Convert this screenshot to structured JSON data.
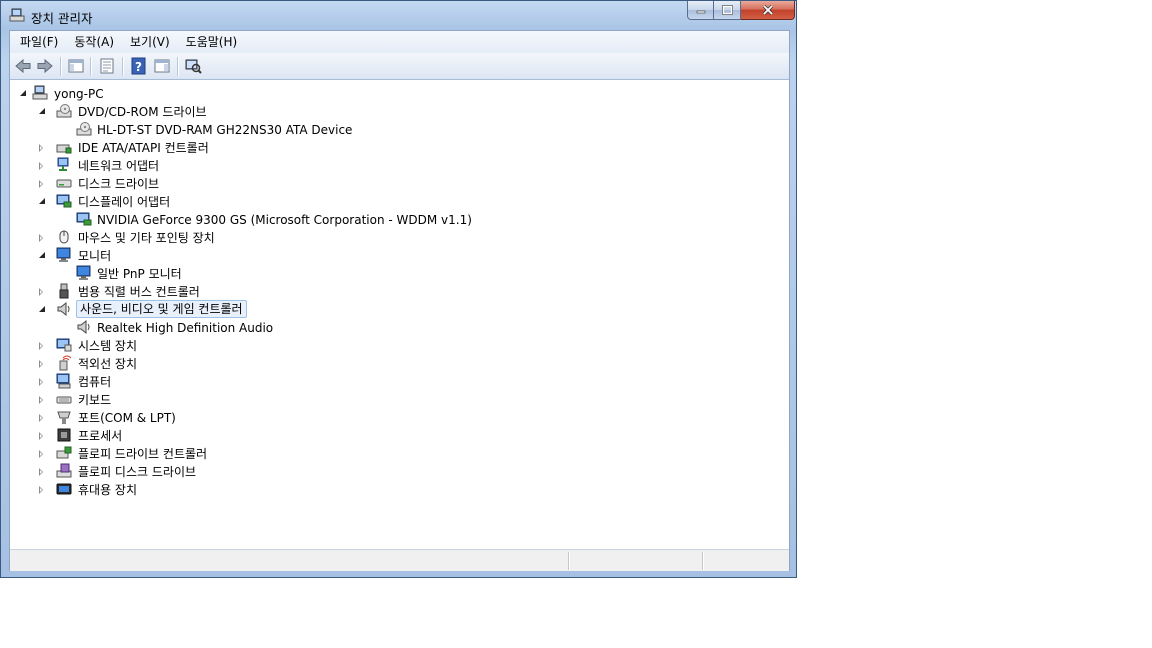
{
  "window": {
    "title": "장치 관리자"
  },
  "menu": [
    "파일(F)",
    "동작(A)",
    "보기(V)",
    "도움말(H)"
  ],
  "toolbar": [
    "back-icon",
    "forward-icon",
    "show-hide-tree-icon",
    "properties-icon",
    "help-icon",
    "action-pane-icon",
    "scan-hardware-icon"
  ],
  "tree": {
    "root": "yong-PC",
    "items": [
      {
        "label": "DVD/CD-ROM 드라이브",
        "icon": "optical-drive-icon",
        "state": "expanded"
      },
      {
        "label": "HL-DT-ST DVD-RAM GH22NS30 ATA Device",
        "icon": "optical-drive-icon",
        "state": "leaf"
      },
      {
        "label": "IDE ATA/ATAPI 컨트롤러",
        "icon": "ide-controller-icon",
        "state": "collapsed"
      },
      {
        "label": "네트워크 어댑터",
        "icon": "network-adapter-icon",
        "state": "collapsed"
      },
      {
        "label": "디스크 드라이브",
        "icon": "disk-drive-icon",
        "state": "collapsed"
      },
      {
        "label": "디스플레이 어댑터",
        "icon": "display-adapter-icon",
        "state": "expanded"
      },
      {
        "label": "NVIDIA GeForce 9300 GS (Microsoft Corporation - WDDM v1.1)",
        "icon": "display-adapter-icon",
        "state": "leaf"
      },
      {
        "label": "마우스 및 기타 포인팅 장치",
        "icon": "mouse-icon",
        "state": "collapsed"
      },
      {
        "label": "모니터",
        "icon": "monitor-icon",
        "state": "expanded"
      },
      {
        "label": "일반 PnP 모니터",
        "icon": "monitor-icon",
        "state": "leaf"
      },
      {
        "label": "범용 직렬 버스 컨트롤러",
        "icon": "usb-icon",
        "state": "collapsed"
      },
      {
        "label": "사운드, 비디오 및 게임 컨트롤러",
        "icon": "speaker-icon",
        "state": "expanded",
        "selected": true
      },
      {
        "label": "Realtek High Definition Audio",
        "icon": "speaker-icon",
        "state": "leaf"
      },
      {
        "label": "시스템 장치",
        "icon": "system-device-icon",
        "state": "collapsed"
      },
      {
        "label": "적외선 장치",
        "icon": "infrared-icon",
        "state": "collapsed"
      },
      {
        "label": "컴퓨터",
        "icon": "computer-icon",
        "state": "collapsed"
      },
      {
        "label": "키보드",
        "icon": "keyboard-icon",
        "state": "collapsed"
      },
      {
        "label": "포트(COM & LPT)",
        "icon": "port-icon",
        "state": "collapsed"
      },
      {
        "label": "프로세서",
        "icon": "processor-icon",
        "state": "collapsed"
      },
      {
        "label": "플로피 드라이브 컨트롤러",
        "icon": "floppy-controller-icon",
        "state": "collapsed"
      },
      {
        "label": "플로피 디스크 드라이브",
        "icon": "floppy-drive-icon",
        "state": "collapsed"
      },
      {
        "label": "휴대용 장치",
        "icon": "portable-device-icon",
        "state": "collapsed"
      }
    ]
  },
  "colors": {
    "frame": "#a9c4e6",
    "selection": "#e8f1fb",
    "close": "#c2412a"
  }
}
